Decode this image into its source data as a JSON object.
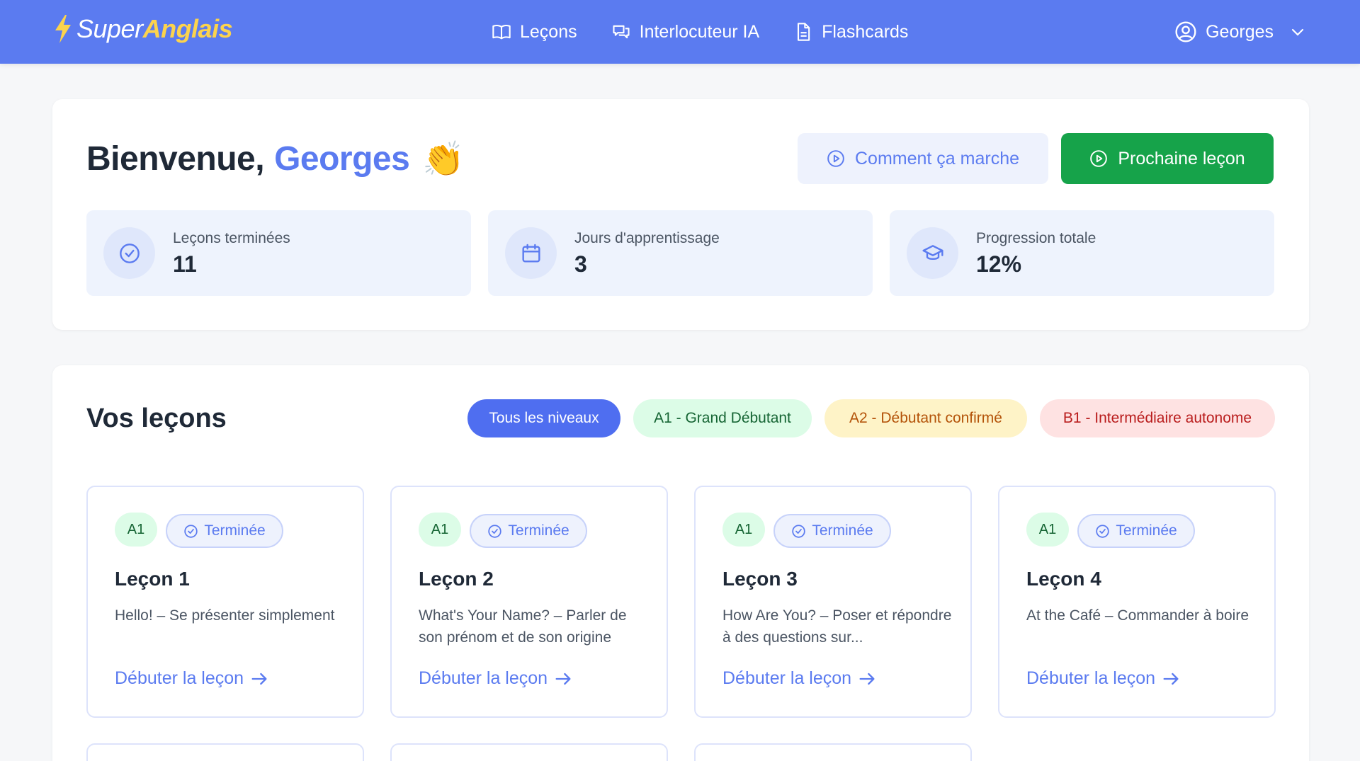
{
  "brand": {
    "part1": "Super",
    "part2": "Anglais",
    "accent": "#fcd34d"
  },
  "nav": {
    "items": [
      {
        "label": "Leçons",
        "icon": "book-icon"
      },
      {
        "label": "Interlocuteur IA",
        "icon": "chat-icon"
      },
      {
        "label": "Flashcards",
        "icon": "document-icon"
      }
    ],
    "user": "Georges"
  },
  "welcome": {
    "greeting": "Bienvenue,",
    "name": "Georges",
    "emoji": "👏",
    "how_label": "Comment ça marche",
    "next_label": "Prochaine leçon"
  },
  "stats": [
    {
      "label": "Leçons terminées",
      "value": "11",
      "icon": "check-circle-icon"
    },
    {
      "label": "Jours d'apprentissage",
      "value": "3",
      "icon": "calendar-icon"
    },
    {
      "label": "Progression totale",
      "value": "12%",
      "icon": "graduation-cap-icon"
    }
  ],
  "lessons_section": {
    "title": "Vos leçons",
    "filters": [
      "Tous les niveaux",
      "A1 - Grand Débutant",
      "A2 - Débutant confirmé",
      "B1 - Intermédiaire autonome"
    ]
  },
  "lessons": [
    {
      "level": "A1",
      "status": "Terminée",
      "title": "Leçon 1",
      "desc": "Hello! – Se présenter simplement",
      "cta": "Débuter la leçon"
    },
    {
      "level": "A1",
      "status": "Terminée",
      "title": "Leçon 2",
      "desc": "What's Your Name? – Parler de son prénom et de son origine",
      "cta": "Débuter la leçon"
    },
    {
      "level": "A1",
      "status": "Terminée",
      "title": "Leçon 3",
      "desc": "How Are You? – Poser et répondre à des questions sur...",
      "cta": "Débuter la leçon"
    },
    {
      "level": "A1",
      "status": "Terminée",
      "title": "Leçon 4",
      "desc": "At the Café – Commander à boire",
      "cta": "Débuter la leçon"
    }
  ],
  "colors": {
    "primary": "#5b7bf0",
    "success": "#16a34a"
  }
}
